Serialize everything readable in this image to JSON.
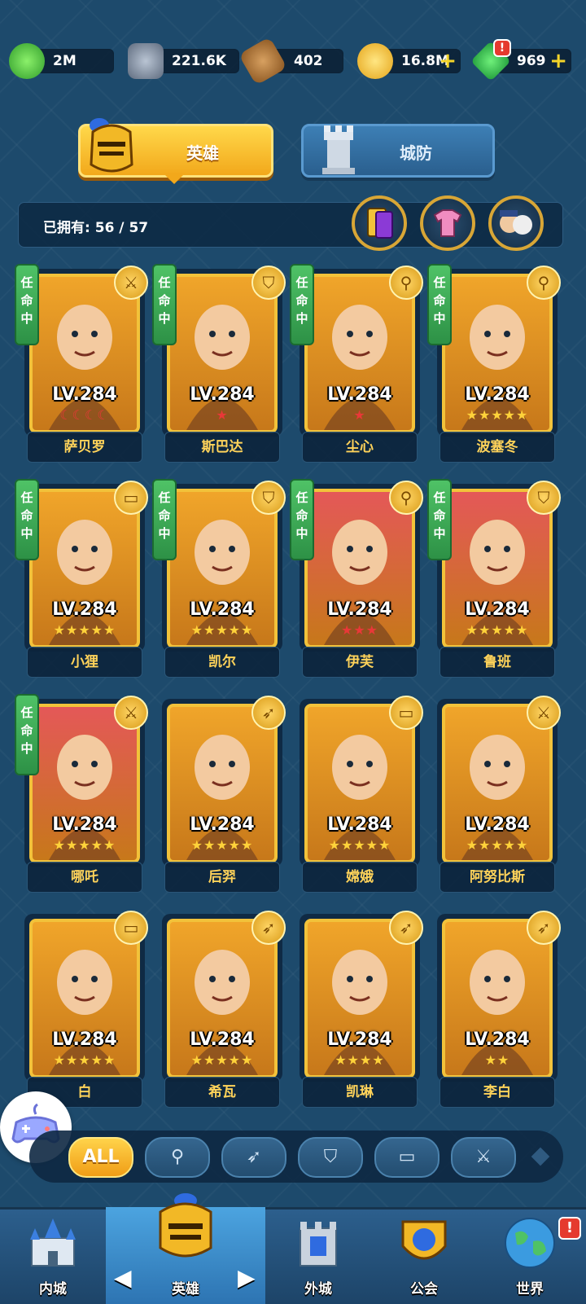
{
  "resources": [
    {
      "name": "green-gem",
      "value": "2M"
    },
    {
      "name": "stone-token",
      "value": "221.6K"
    },
    {
      "name": "hammer",
      "value": "402"
    },
    {
      "name": "gold-coin",
      "value": "16.8M"
    },
    {
      "name": "emerald",
      "value": "969"
    }
  ],
  "tabs": {
    "hero": "英雄",
    "defense": "城防"
  },
  "owned": {
    "label": "已拥有:",
    "count": "56 / 57"
  },
  "appoint_label": "任\n命\n中",
  "heroes": [
    {
      "name": "萨贝罗",
      "level": "LV.284",
      "stars": "☾☾☾☾",
      "star_color": "#e83838",
      "appointed": true,
      "class_icon": "sword-icon",
      "color": "#f0a52a"
    },
    {
      "name": "斯巴达",
      "level": "LV.284",
      "stars": "★",
      "star_color": "#e83838",
      "appointed": true,
      "class_icon": "shield-icon",
      "color": "#f0a52a"
    },
    {
      "name": "尘心",
      "level": "LV.284",
      "stars": "★",
      "star_color": "#e83838",
      "appointed": true,
      "class_icon": "staff-icon",
      "color": "#f0a52a"
    },
    {
      "name": "波塞冬",
      "level": "LV.284",
      "stars": "★★★★★",
      "star_color": "#ffd23a",
      "appointed": true,
      "class_icon": "staff-icon",
      "color": "#f0a52a"
    },
    {
      "name": "小狸",
      "level": "LV.284",
      "stars": "★★★★★",
      "star_color": "#ffd23a",
      "appointed": true,
      "class_icon": "book-icon",
      "color": "#f0a52a"
    },
    {
      "name": "凯尔",
      "level": "LV.284",
      "stars": "★★★★★",
      "star_color": "#ffd23a",
      "appointed": true,
      "class_icon": "shield-icon",
      "color": "#f0a52a"
    },
    {
      "name": "伊芙",
      "level": "LV.284",
      "stars": "★★★",
      "star_color": "#e83838",
      "appointed": true,
      "class_icon": "staff-icon",
      "color": "#e45858"
    },
    {
      "name": "鲁班",
      "level": "LV.284",
      "stars": "★★★★★",
      "star_color": "#ffd23a",
      "appointed": true,
      "class_icon": "shield-icon",
      "color": "#e45858"
    },
    {
      "name": "哪吒",
      "level": "LV.284",
      "stars": "★★★★★",
      "star_color": "#ffd23a",
      "appointed": true,
      "class_icon": "sword-icon",
      "color": "#e45858"
    },
    {
      "name": "后羿",
      "level": "LV.284",
      "stars": "★★★★★",
      "star_color": "#ffd23a",
      "appointed": false,
      "class_icon": "bow-icon",
      "color": "#f0a52a"
    },
    {
      "name": "嫦娥",
      "level": "LV.284",
      "stars": "★★★★★",
      "star_color": "#ffd23a",
      "appointed": false,
      "class_icon": "book-icon",
      "color": "#f0a52a"
    },
    {
      "name": "阿努比斯",
      "level": "LV.284",
      "stars": "★★★★★",
      "star_color": "#ffd23a",
      "appointed": false,
      "class_icon": "sword-icon",
      "color": "#f0a52a"
    },
    {
      "name": "白",
      "level": "LV.284",
      "stars": "★★★★★",
      "star_color": "#ffd23a",
      "appointed": false,
      "class_icon": "book-icon",
      "color": "#f0a52a"
    },
    {
      "name": "希瓦",
      "level": "LV.284",
      "stars": "★★★★★",
      "star_color": "#ffd23a",
      "appointed": false,
      "class_icon": "bow-icon",
      "color": "#f0a52a"
    },
    {
      "name": "凯琳",
      "level": "LV.284",
      "stars": "★★★★",
      "star_color": "#ffd23a",
      "appointed": false,
      "class_icon": "bow-icon",
      "color": "#f0a52a"
    },
    {
      "name": "李白",
      "level": "LV.284",
      "stars": "★★",
      "star_color": "#ffd23a",
      "appointed": false,
      "class_icon": "bow-icon",
      "color": "#f0a52a"
    }
  ],
  "filters": {
    "all": "ALL"
  },
  "nav": {
    "inner": "内城",
    "hero": "英雄",
    "outer": "外城",
    "guild": "公会",
    "world": "世界"
  },
  "badges": {
    "emerald": "!",
    "world": "!"
  }
}
